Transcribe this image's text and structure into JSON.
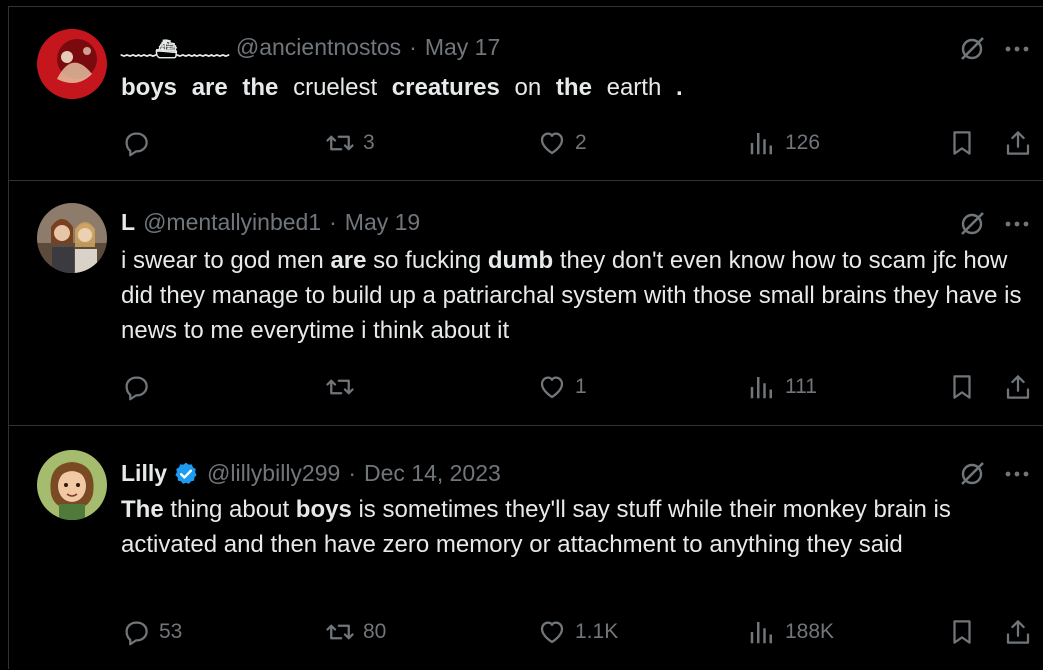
{
  "tweets": [
    {
      "name": "﹏﹏⛴﹏﹏﹏",
      "handle": "@ancientnostos",
      "dot": "·",
      "date": "May 17",
      "text": [
        "boys",
        "are",
        "the",
        "cruelest",
        "creatures",
        "on",
        "the",
        "earth",
        "."
      ],
      "counts": {
        "reply": "",
        "repost": "3",
        "like": "2",
        "views": "126"
      },
      "avatar_colors": [
        "#c4161c",
        "#7a0a0e"
      ]
    },
    {
      "name": "L",
      "handle": "@mentallyinbed1",
      "dot": "·",
      "date": "May 19",
      "text": [
        "i swear to god men ",
        "are",
        " so fucking ",
        "dumb",
        " they don't even know how to scam jfc how did they manage to build up a patriarchal system with those small brains they have is news to me everytime i think about it"
      ],
      "counts": {
        "reply": "",
        "repost": "",
        "like": "1",
        "views": "111"
      },
      "avatar_colors": [
        "#6b5a4c",
        "#b8a690"
      ]
    },
    {
      "name": "Lilly",
      "handle": "@lillybilly299",
      "dot": "·",
      "date": "Dec 14, 2023",
      "text": [
        "The",
        " thing about ",
        "boys",
        " is sometimes they'll say stuff while their monkey brain is activated and then have zero memory or attachment to anything they said"
      ],
      "counts": {
        "reply": "53",
        "repost": "80",
        "like": "1.1K",
        "views": "188K"
      },
      "avatar_colors": [
        "#a5bb6e",
        "#7a4a22"
      ]
    }
  ],
  "colors": {
    "accent": "#1d9bf0",
    "muted": "#71767b",
    "text": "#e7e9ea",
    "border": "#2f3336"
  },
  "icons": [
    "grok-icon",
    "more-icon",
    "reply-icon",
    "repost-icon",
    "like-icon",
    "views-icon",
    "bookmark-icon",
    "share-icon",
    "verified-badge-icon"
  ]
}
